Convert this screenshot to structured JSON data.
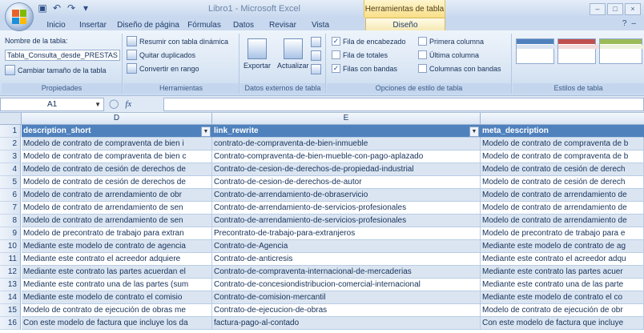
{
  "window": {
    "app_title": "Libro1 - Microsoft Excel",
    "context_title": "Herramientas de tabla",
    "controls": [
      "–",
      "□",
      "×"
    ]
  },
  "tabs": [
    {
      "label": "Inicio"
    },
    {
      "label": "Insertar"
    },
    {
      "label": "Diseño de página"
    },
    {
      "label": "Fórmulas"
    },
    {
      "label": "Datos"
    },
    {
      "label": "Revisar"
    },
    {
      "label": "Vista"
    },
    {
      "label": "Diseño",
      "active": true
    }
  ],
  "ribbon": {
    "propiedades": {
      "name_label": "Nombre de la tabla:",
      "table_name": "Tabla_Consulta_desde_PRESTAS",
      "resize": "Cambiar tamaño de la tabla",
      "group_label": "Propiedades"
    },
    "herramientas": {
      "items": [
        "Resumir con tabla dinámica",
        "Quitar duplicados",
        "Convertir en rango"
      ],
      "group_label": "Herramientas"
    },
    "datos_externos": {
      "export": "Exportar",
      "refresh": "Actualizar",
      "group_label": "Datos externos de tabla"
    },
    "opciones": {
      "checks": [
        {
          "label": "Fila de encabezado",
          "checked": true
        },
        {
          "label": "Fila de totales",
          "checked": false
        },
        {
          "label": "Filas con bandas",
          "checked": true
        },
        {
          "label": "Primera columna",
          "checked": false
        },
        {
          "label": "Última columna",
          "checked": false
        },
        {
          "label": "Columnas con bandas",
          "checked": false
        }
      ],
      "group_label": "Opciones de estilo de tabla"
    },
    "estilos": {
      "group_label": "Estilos de tabla",
      "swatch_colors": [
        "#4f81bd",
        "#c0504d",
        "#9bbb59"
      ]
    }
  },
  "formula_bar": {
    "cell_ref": "A1",
    "fx": "fx",
    "content": ""
  },
  "columns": [
    "D",
    "E"
  ],
  "table": {
    "headers": [
      "description_short",
      "link_rewrite",
      "meta_description"
    ],
    "rows": [
      {
        "num": "1"
      },
      {
        "num": "2",
        "d": "Modelo de contrato de compraventa de bien i",
        "e": "contrato-de-compraventa-de-bien-inmueble",
        "f": "Modelo de contrato de compraventa de b"
      },
      {
        "num": "3",
        "d": "Modelo de contrato de compraventa de bien c",
        "e": "Contrato-compraventa-de-bien-mueble-con-pago-aplazado",
        "f": "Modelo de contrato de compraventa de b"
      },
      {
        "num": "4",
        "d": "Modelo de contrato de cesión de derechos de",
        "e": "Contrato-de-cesion-de-derechos-de-propiedad-industrial",
        "f": "Modelo de contrato de cesión de derech"
      },
      {
        "num": "5",
        "d": "Modelo de contrato de cesión de derechos de",
        "e": "Contrato-de-cesion-de-derechos-de-autor",
        "f": "Modelo de contrato de cesión de derech"
      },
      {
        "num": "6",
        "d": "Modelo de contrato de arrendamiento de obr",
        "e": "Contrato-de-arrendamiento-de-obraservicio",
        "f": "Modelo de contrato de arrendamiento de"
      },
      {
        "num": "7",
        "d": "Modelo de contrato de arrendamiento de sen",
        "e": "Contrato-de-arrendamiento-de-servicios-profesionales",
        "f": "Modelo de contrato de arrendamiento de"
      },
      {
        "num": "8",
        "d": "Modelo de contrato de arrendamiento de sen",
        "e": "Contrato-de-arrendamiento-de-servicios-profesionales",
        "f": "Modelo de contrato de arrendamiento de"
      },
      {
        "num": "9",
        "d": "Modelo de precontrato de trabajo para extran",
        "e": "Precontrato-de-trabajo-para-extranjeros",
        "f": "Modelo de precontrato de trabajo para e"
      },
      {
        "num": "10",
        "d": "Mediante este modelo de contrato de agencia",
        "e": "Contrato-de-Agencia",
        "f": "Mediante este modelo de contrato de ag"
      },
      {
        "num": "11",
        "d": "Mediante este contrato el acreedor adquiere",
        "e": "Contrato-de-anticresis",
        "f": "Mediante este contrato el acreedor adqu"
      },
      {
        "num": "12",
        "d": "Mediante este contrato las partes acuerdan el",
        "e": "Contrato-de-compraventa-internacional-de-mercaderias",
        "f": "Mediante este contrato las partes acuer"
      },
      {
        "num": "13",
        "d": "Mediante este contrato una de las partes (sum",
        "e": "Contrato-de-concesiondistribucion-comercial-internacional",
        "f": "Mediante este contrato una de las parte"
      },
      {
        "num": "14",
        "d": "Mediante este modelo de contrato el comisio",
        "e": "Contrato-de-comision-mercantil",
        "f": "Mediante este modelo de contrato el co"
      },
      {
        "num": "15",
        "d": "Modelo de contrato de ejecución de obras me",
        "e": "Contrato-de-ejecucion-de-obras",
        "f": "Modelo de contrato de ejecución de obr"
      },
      {
        "num": "16",
        "d": "Con este modelo de factura que incluye los da",
        "e": "factura-pago-al-contado",
        "f": "Con este modelo de factura que incluye"
      }
    ]
  }
}
